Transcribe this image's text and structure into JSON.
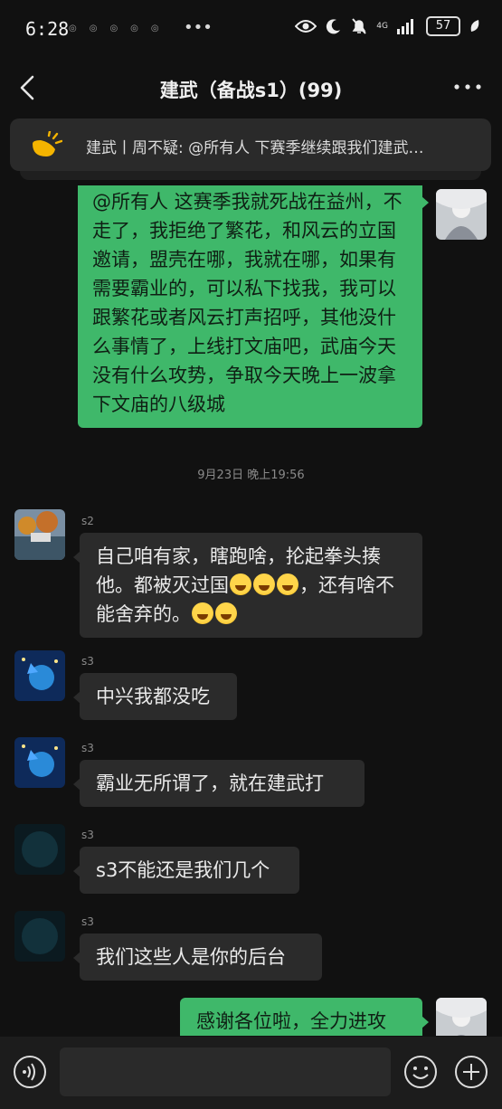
{
  "status": {
    "time": "6:28",
    "network": "4G",
    "battery": "57"
  },
  "header": {
    "title": "建武（备战s1）(99)"
  },
  "notice": {
    "text": "建武丨周不疑: @所有人 下赛季继续跟我们建武…"
  },
  "messages": [
    {
      "side": "out",
      "text": "@所有人 这赛季我就死战在益州，不走了，我拒绝了繁花，和风云的立国邀请，盟壳在哪，我就在哪，如果有需要霸业的，可以私下找我，我可以跟繁花或者风云打声招呼，其他没什么事情了，上线打文庙吧，武庙今天没有什么攻势，争取今天晚上一波拿下文庙的八级城"
    },
    {
      "timestamp": "9月23日 晚上19:56"
    },
    {
      "side": "in",
      "name": "s2",
      "text_a": "自己咱有家，瞎跑啥，抡起拳头揍他。都被灭过国",
      "text_b": "，还有啥不能舍弃的。"
    },
    {
      "side": "in",
      "name": "s3",
      "text": "中兴我都没吃"
    },
    {
      "side": "in",
      "name": "s3",
      "text": "霸业无所谓了，就在建武打"
    },
    {
      "side": "in",
      "name": "s3",
      "text": "s3不能还是我们几个"
    },
    {
      "side": "in",
      "name": "s3",
      "text": "我们这些人是你的后台"
    },
    {
      "side": "out",
      "text": "感谢各位啦，全力进攻"
    }
  ],
  "input": {
    "placeholder": ""
  },
  "colors": {
    "background": "#111111",
    "bubble_out": "#3fb86a",
    "bubble_in": "#2b2b2b"
  },
  "icons": [
    "back-icon",
    "more-icon",
    "megaphone-icon",
    "voice-icon",
    "emoji-icon",
    "plus-icon"
  ]
}
